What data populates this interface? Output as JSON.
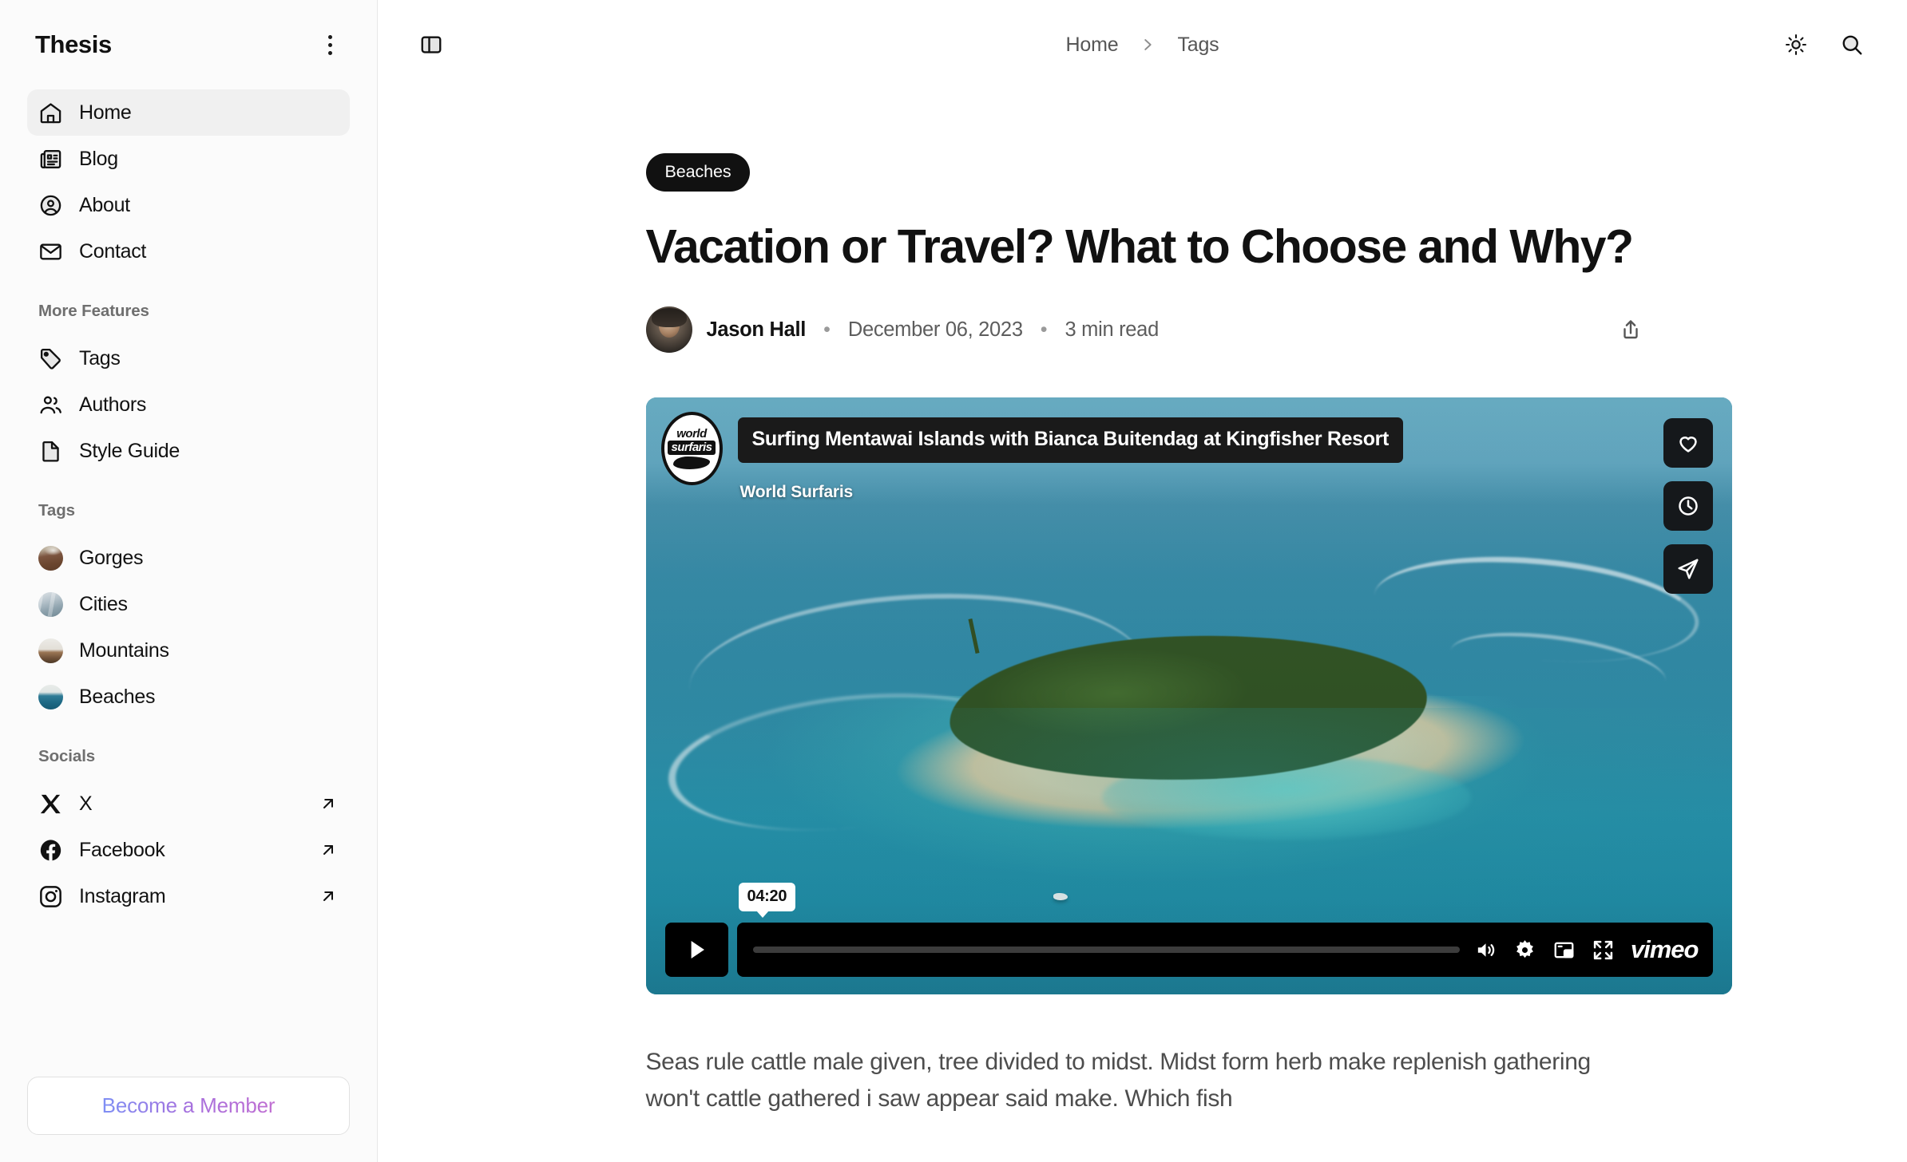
{
  "sidebar": {
    "title": "Thesis",
    "menu_icon": "kebab-menu-icon",
    "primary": [
      {
        "label": "Home",
        "icon": "home-icon",
        "active": true
      },
      {
        "label": "Blog",
        "icon": "newspaper-icon",
        "active": false
      },
      {
        "label": "About",
        "icon": "user-circle-icon",
        "active": false
      },
      {
        "label": "Contact",
        "icon": "mail-icon",
        "active": false
      }
    ],
    "more_features_label": "More Features",
    "more_features": [
      {
        "label": "Tags",
        "icon": "tag-icon"
      },
      {
        "label": "Authors",
        "icon": "users-icon"
      },
      {
        "label": "Style Guide",
        "icon": "document-icon"
      }
    ],
    "tags_label": "Tags",
    "tags": [
      {
        "label": "Gorges",
        "avatar": "gorges-thumbnail"
      },
      {
        "label": "Cities",
        "avatar": "cities-thumbnail"
      },
      {
        "label": "Mountains",
        "avatar": "mountains-thumbnail"
      },
      {
        "label": "Beaches",
        "avatar": "beaches-thumbnail"
      }
    ],
    "socials_label": "Socials",
    "socials": [
      {
        "label": "X",
        "icon": "x-logo-icon"
      },
      {
        "label": "Facebook",
        "icon": "facebook-logo-icon"
      },
      {
        "label": "Instagram",
        "icon": "instagram-logo-icon"
      }
    ],
    "member_button": "Become a Member"
  },
  "topbar": {
    "panel_toggle_icon": "sidebar-toggle-icon",
    "breadcrumb": [
      "Home",
      "Tags"
    ],
    "breadcrumb_separator": "›",
    "theme_icon": "sun-icon",
    "search_icon": "search-icon"
  },
  "article": {
    "tag": "Beaches",
    "title": "Vacation or Travel? What to Choose and Why?",
    "author": "Jason Hall",
    "date": "December 06, 2023",
    "read_time": "3 min read",
    "separator": "•",
    "share_icon": "share-icon",
    "body": "Seas rule cattle male given, tree divided to midst. Midst form herb make replenish gathering won't cattle gathered i saw appear said make. Which fish"
  },
  "video": {
    "provider": "vimeo",
    "provider_wordmark": "vimeo",
    "channel_logo_line1": "world",
    "channel_logo_line2": "surfaris",
    "title": "Surfing Mentawai Islands with Bianca Buitendag at Kingfisher Resort",
    "owner": "World Surfaris",
    "time_tooltip": "04:20",
    "play_icon": "play-icon",
    "side_actions": [
      {
        "icon": "heart-icon"
      },
      {
        "icon": "clock-icon"
      },
      {
        "icon": "share-paper-plane-icon"
      }
    ],
    "controls": [
      {
        "icon": "volume-icon"
      },
      {
        "icon": "gear-icon"
      },
      {
        "icon": "picture-in-picture-icon"
      },
      {
        "icon": "fullscreen-icon"
      }
    ]
  },
  "colors": {
    "sidebar_bg": "#fbfbfb",
    "active_item": "#f0f0f0",
    "tag_pill_bg": "#111111",
    "member_gradient_start": "#7f8ff4",
    "member_gradient_end": "#c06fd2"
  }
}
